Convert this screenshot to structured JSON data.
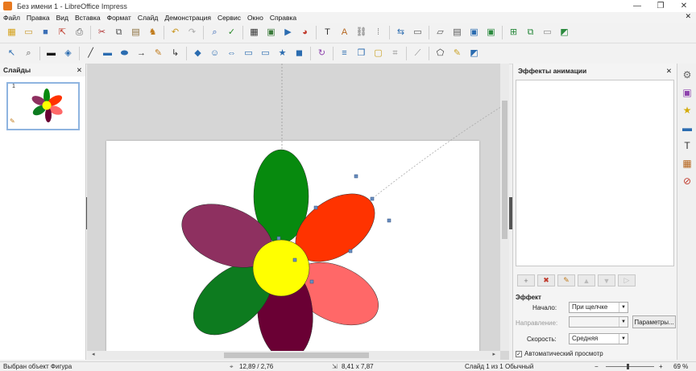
{
  "window": {
    "title": "Без имени 1 - LibreOffice Impress",
    "min": "—",
    "restore": "❐",
    "close": "✕"
  },
  "menu": [
    "Файл",
    "Правка",
    "Вид",
    "Вставка",
    "Формат",
    "Слайд",
    "Демонстрация",
    "Сервис",
    "Окно",
    "Справка"
  ],
  "menu_close": "✕",
  "toolbar1": [
    {
      "name": "new-icon",
      "glyph": "▦",
      "color": "#d4a017"
    },
    {
      "name": "open-icon",
      "glyph": "▭",
      "color": "#c99a2e"
    },
    {
      "name": "save-icon",
      "glyph": "■",
      "color": "#3b6fb6"
    },
    {
      "name": "export-pdf-icon",
      "glyph": "⇱",
      "color": "#c0392b"
    },
    {
      "name": "print-icon",
      "glyph": "⎙",
      "color": "#555"
    },
    {
      "name": "cut-icon",
      "glyph": "✂",
      "color": "#b03030"
    },
    {
      "name": "copy-icon",
      "glyph": "⧉",
      "color": "#555"
    },
    {
      "name": "paste-icon",
      "glyph": "▤",
      "color": "#8a6d3b"
    },
    {
      "name": "clone-formatting-icon",
      "glyph": "♞",
      "color": "#c07a1a"
    },
    {
      "name": "undo-icon",
      "glyph": "↶",
      "color": "#c9961f"
    },
    {
      "name": "redo-icon",
      "glyph": "↷",
      "color": "#aaa"
    },
    {
      "name": "find-replace-icon",
      "glyph": "⌕",
      "color": "#2a5db0"
    },
    {
      "name": "spelling-icon",
      "glyph": "✓",
      "color": "#2a8a2a"
    },
    {
      "name": "table-icon",
      "glyph": "▦",
      "color": "#333"
    },
    {
      "name": "image-icon",
      "glyph": "▣",
      "color": "#3a7a3a"
    },
    {
      "name": "media-icon",
      "glyph": "▶",
      "color": "#2b6cb0"
    },
    {
      "name": "chart-icon",
      "glyph": "◕",
      "color": "#c0392b"
    },
    {
      "name": "textbox-icon",
      "glyph": "T",
      "color": "#333"
    },
    {
      "name": "fontwork-icon",
      "glyph": "A",
      "color": "#b5651d"
    },
    {
      "name": "hyperlink-icon",
      "glyph": "⛓",
      "color": "#666"
    },
    {
      "name": "grid-icon",
      "glyph": "⁞",
      "color": "#888"
    },
    {
      "name": "helplines-icon",
      "glyph": "⇆",
      "color": "#2b6cb0"
    },
    {
      "name": "master-slide-icon",
      "glyph": "▭",
      "color": "#555"
    },
    {
      "name": "display-views-icon",
      "glyph": "▱",
      "color": "#555"
    },
    {
      "name": "slide-layout-icon",
      "glyph": "▤",
      "color": "#555"
    },
    {
      "name": "start-first-icon",
      "glyph": "▣",
      "color": "#2b6cb0"
    },
    {
      "name": "start-current-icon",
      "glyph": "▣",
      "color": "#2b8a3e"
    },
    {
      "name": "new-slide-icon",
      "glyph": "⊞",
      "color": "#2b8a3e"
    },
    {
      "name": "duplicate-slide-icon",
      "glyph": "⧉",
      "color": "#2b8a3e"
    },
    {
      "name": "delete-slide-icon",
      "glyph": "▭",
      "color": "#888"
    },
    {
      "name": "slide-transition-icon",
      "glyph": "◩",
      "color": "#2b8a3e"
    }
  ],
  "toolbar2": [
    {
      "name": "select-icon",
      "glyph": "↖",
      "color": "#2b6cb0"
    },
    {
      "name": "zoom-pan-icon",
      "glyph": "⌕",
      "color": "#555"
    },
    {
      "name": "line-color-icon",
      "glyph": "▬",
      "color": "#111"
    },
    {
      "name": "fill-color-icon",
      "glyph": "◈",
      "color": "#2b6cb0"
    },
    {
      "name": "line-icon",
      "glyph": "╱",
      "color": "#333"
    },
    {
      "name": "rectangle-icon",
      "glyph": "▬",
      "color": "#2b6cb0"
    },
    {
      "name": "ellipse-icon",
      "glyph": "⬬",
      "color": "#2b6cb0"
    },
    {
      "name": "lines-arrows-icon",
      "glyph": "→",
      "color": "#333"
    },
    {
      "name": "curves-icon",
      "glyph": "✎",
      "color": "#c07a1a"
    },
    {
      "name": "connectors-icon",
      "glyph": "↳",
      "color": "#333"
    },
    {
      "name": "basic-shapes-icon",
      "glyph": "◆",
      "color": "#2b6cb0"
    },
    {
      "name": "symbol-shapes-icon",
      "glyph": "☺",
      "color": "#2b6cb0"
    },
    {
      "name": "block-arrows-icon",
      "glyph": "⇔",
      "color": "#2b6cb0"
    },
    {
      "name": "flowchart-icon",
      "glyph": "▭",
      "color": "#2b6cb0"
    },
    {
      "name": "callouts-icon",
      "glyph": "▭",
      "color": "#2b6cb0"
    },
    {
      "name": "stars-icon",
      "glyph": "★",
      "color": "#2b6cb0"
    },
    {
      "name": "3d-objects-icon",
      "glyph": "◼",
      "color": "#2b6cb0"
    },
    {
      "name": "rotate-icon",
      "glyph": "↻",
      "color": "#8e44ad"
    },
    {
      "name": "align-icon",
      "glyph": "≡",
      "color": "#2b6cb0"
    },
    {
      "name": "arrange-icon",
      "glyph": "❐",
      "color": "#2b6cb0"
    },
    {
      "name": "shadow-icon",
      "glyph": "▢",
      "color": "#c9a227"
    },
    {
      "name": "crop-icon",
      "glyph": "⌗",
      "color": "#888"
    },
    {
      "name": "filter-icon",
      "glyph": "⟋",
      "color": "#888"
    },
    {
      "name": "points-icon",
      "glyph": "⬠",
      "color": "#333"
    },
    {
      "name": "glue-points-icon",
      "glyph": "✎",
      "color": "#c9a227"
    },
    {
      "name": "toggle-extrusion-icon",
      "glyph": "◩",
      "color": "#2b6cb0"
    }
  ],
  "slides_pane": {
    "title": "Слайды",
    "close": "✕",
    "slide_number": "1"
  },
  "sidebar": {
    "title": "Эффекты анимации",
    "close": "✕",
    "effect_section": "Эффект",
    "start_label": "Начало:",
    "start_value": "При щелчке",
    "direction_label": "Направление:",
    "direction_value": "",
    "params_button": "Параметры...",
    "speed_label": "Скорость:",
    "speed_value": "Средняя",
    "autopreview_label": "Автоматический просмотр",
    "autopreview_checked": true,
    "anim_buttons": [
      {
        "name": "add-effect-button",
        "glyph": "+",
        "color": "#777"
      },
      {
        "name": "remove-effect-button",
        "glyph": "✖",
        "color": "#c0392b"
      },
      {
        "name": "change-effect-button",
        "glyph": "✎",
        "color": "#c07a1a"
      },
      {
        "name": "move-up-button",
        "glyph": "▲",
        "color": "#bbb"
      },
      {
        "name": "move-down-button",
        "glyph": "▼",
        "color": "#bbb"
      },
      {
        "name": "preview-effect-button",
        "glyph": "▷",
        "color": "#bbb"
      }
    ]
  },
  "sidedeck": [
    {
      "name": "properties-icon",
      "glyph": "⚙",
      "color": "#666"
    },
    {
      "name": "slide-transition-deck-icon",
      "glyph": "▣",
      "color": "#8e44ad"
    },
    {
      "name": "animation-deck-icon",
      "glyph": "★",
      "color": "#d4ac0d"
    },
    {
      "name": "master-slides-deck-icon",
      "glyph": "▬",
      "color": "#2b6cb0"
    },
    {
      "name": "styles-deck-icon",
      "glyph": "T",
      "color": "#333"
    },
    {
      "name": "gallery-deck-icon",
      "glyph": "▦",
      "color": "#b5651d"
    },
    {
      "name": "navigator-deck-icon",
      "glyph": "⊘",
      "color": "#c0392b"
    }
  ],
  "status": {
    "selection": "Выбран объект Фигура",
    "position": "12,89 / 2,76",
    "size": "8,41 x 7,87",
    "slide": "Слайд 1 из 1",
    "master": "Обычный",
    "zoom": "69 %"
  },
  "colors": {
    "green": "#078a0e",
    "dark_green": "#0d7b1f",
    "red_orange": "#ff3300",
    "salmon": "#ff6868",
    "plum": "#8e3060",
    "maroon": "#6a0034",
    "yellow": "#ffff00"
  }
}
